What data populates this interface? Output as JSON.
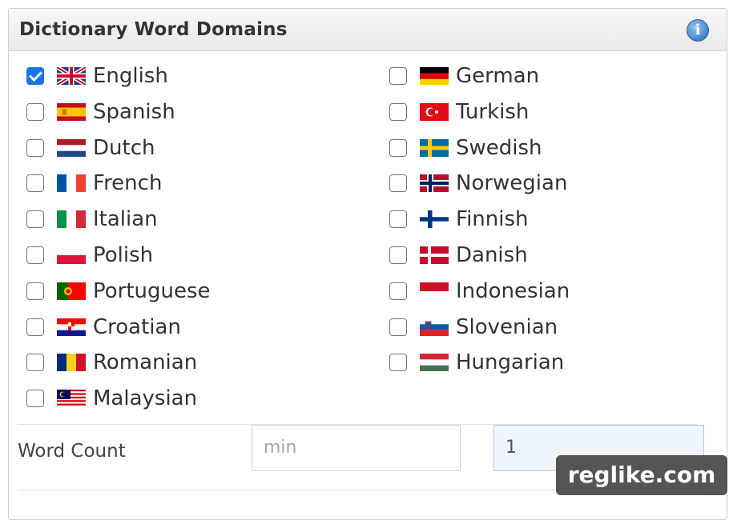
{
  "panel": {
    "title": "Dictionary Word Domains",
    "info_icon": "info-icon",
    "accent": "#1a73e8"
  },
  "languages": [
    {
      "label": "English",
      "checked": true,
      "flag": "gb"
    },
    {
      "label": "Spanish",
      "checked": false,
      "flag": "es"
    },
    {
      "label": "Dutch",
      "checked": false,
      "flag": "nl"
    },
    {
      "label": "French",
      "checked": false,
      "flag": "fr"
    },
    {
      "label": "Italian",
      "checked": false,
      "flag": "it"
    },
    {
      "label": "Polish",
      "checked": false,
      "flag": "pl"
    },
    {
      "label": "Portuguese",
      "checked": false,
      "flag": "pt"
    },
    {
      "label": "Croatian",
      "checked": false,
      "flag": "hr"
    },
    {
      "label": "Romanian",
      "checked": false,
      "flag": "ro"
    },
    {
      "label": "Malaysian",
      "checked": false,
      "flag": "my"
    },
    {
      "label": "German",
      "checked": false,
      "flag": "de"
    },
    {
      "label": "Turkish",
      "checked": false,
      "flag": "tr"
    },
    {
      "label": "Swedish",
      "checked": false,
      "flag": "se"
    },
    {
      "label": "Norwegian",
      "checked": false,
      "flag": "no"
    },
    {
      "label": "Finnish",
      "checked": false,
      "flag": "fi"
    },
    {
      "label": "Danish",
      "checked": false,
      "flag": "dk"
    },
    {
      "label": "Indonesian",
      "checked": false,
      "flag": "id"
    },
    {
      "label": "Slovenian",
      "checked": false,
      "flag": "si"
    },
    {
      "label": "Hungarian",
      "checked": false,
      "flag": "hu"
    }
  ],
  "word_count": {
    "label": "Word Count",
    "min_placeholder": "min",
    "max_value": "1"
  },
  "watermark": "reglike.com"
}
